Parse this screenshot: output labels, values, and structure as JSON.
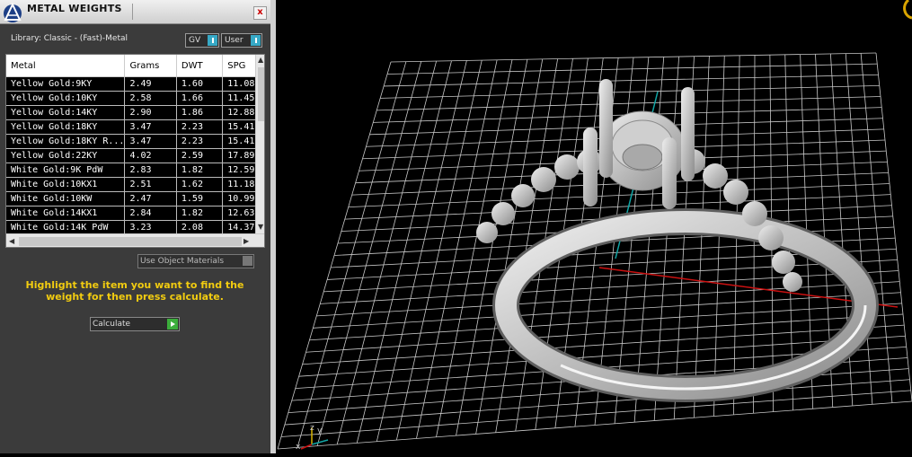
{
  "panel": {
    "title": "METAL WEIGHTS",
    "close_label": "x",
    "library_label": "Library: Classic - (Fast)-Metal",
    "toggles": [
      {
        "label": "GV"
      },
      {
        "label": "User"
      }
    ],
    "columns": [
      "Metal",
      "Grams",
      "DWT",
      "SPG"
    ],
    "rows": [
      [
        "Yellow Gold:9KY",
        "2.49",
        "1.60",
        "11.08"
      ],
      [
        "Yellow Gold:10KY",
        "2.58",
        "1.66",
        "11.45"
      ],
      [
        "Yellow Gold:14KY",
        "2.90",
        "1.86",
        "12.88"
      ],
      [
        "Yellow Gold:18KY",
        "3.47",
        "2.23",
        "15.41"
      ],
      [
        "Yellow Gold:18KY R...",
        "3.47",
        "2.23",
        "15.41"
      ],
      [
        "Yellow Gold:22KY",
        "4.02",
        "2.59",
        "17.89"
      ],
      [
        "White Gold:9K PdW",
        "2.83",
        "1.82",
        "12.59"
      ],
      [
        "White Gold:10KX1",
        "2.51",
        "1.62",
        "11.18"
      ],
      [
        "White Gold:10KW",
        "2.47",
        "1.59",
        "10.99"
      ],
      [
        "White Gold:14KX1",
        "2.84",
        "1.82",
        "12.63"
      ],
      [
        "White Gold:14K PdW",
        "3.23",
        "2.08",
        "14.37"
      ]
    ],
    "use_object_materials_label": "Use Object Materials",
    "instruction": "Highlight the item you want to find the weight for then press calculate.",
    "calculate_label": "Calculate"
  },
  "viewport": {
    "axis_z": "z",
    "axis_y": "y",
    "axis_x": "x"
  },
  "colors": {
    "instruction": "#f2cc10",
    "toggle_accent": "#36a9c6",
    "calculate_go": "#3cae3c",
    "axis_x": "#cc1111",
    "axis_y": "#11a6a6",
    "grid": "#c8c8c8"
  }
}
